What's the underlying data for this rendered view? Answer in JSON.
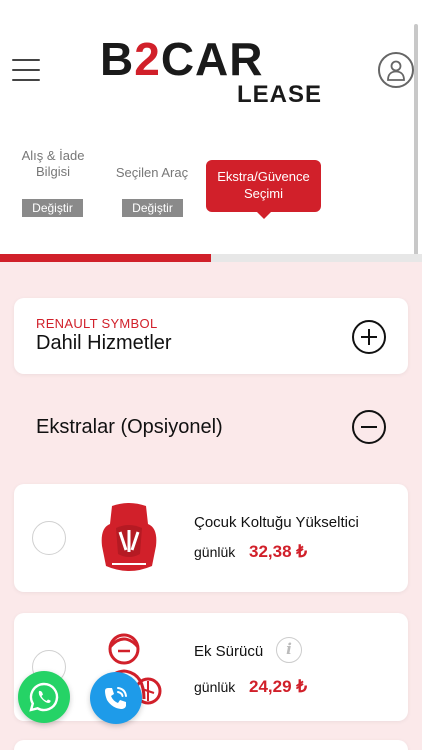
{
  "brand": {
    "logo_main_prefix": "B",
    "logo_main_accent": "2",
    "logo_main_suffix": "CAR",
    "logo_sub": "LEASE",
    "accent_color": "#d1202a"
  },
  "steps": [
    {
      "label": "Alış & İade\nBilgisi",
      "change_label": "Değiştir"
    },
    {
      "label": "Seçilen Araç",
      "change_label": "Değiştir"
    },
    {
      "label": "Ekstra/Güvence\nSeçimi",
      "active": true
    }
  ],
  "progress": {
    "fraction": 0.5
  },
  "vehicle": {
    "model": "RENAULT SYMBOL",
    "title": "Dahil Hizmetler",
    "toggle_icon": "plus-circle-icon"
  },
  "extras": {
    "title": "Ekstralar (Opsiyonel)",
    "toggle_icon": "minus-circle-icon",
    "items": [
      {
        "name": "Çocuk Koltuğu Yükseltici",
        "unit": "günlük",
        "price": "32,38 ₺",
        "icon": "child-seat-icon"
      },
      {
        "name": "Ek Sürücü",
        "unit": "günlük",
        "price": "24,29 ₺",
        "icon": "additional-driver-icon",
        "info_icon": "info-icon"
      }
    ]
  },
  "floating": {
    "whatsapp_icon": "whatsapp-icon",
    "call_icon": "phone-call-icon"
  }
}
